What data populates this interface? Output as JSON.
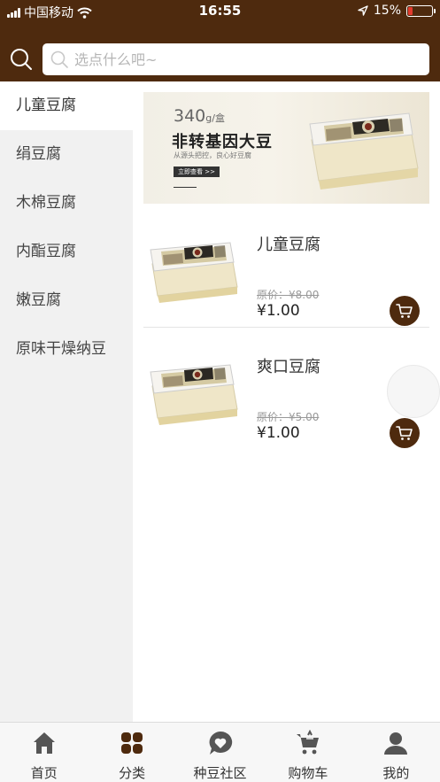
{
  "status_bar": {
    "carrier": "中国移动",
    "time": "16:55",
    "battery": "15%"
  },
  "search": {
    "placeholder": "选点什么吧~"
  },
  "categories": [
    {
      "label": "儿童豆腐",
      "active": true
    },
    {
      "label": "绢豆腐",
      "active": false
    },
    {
      "label": "木棉豆腐",
      "active": false
    },
    {
      "label": "内酯豆腐",
      "active": false
    },
    {
      "label": "嫩豆腐",
      "active": false
    },
    {
      "label": "原味干燥纳豆",
      "active": false
    }
  ],
  "banner": {
    "weight": "340",
    "weight_unit": "g/盒",
    "title": "非转基因大豆",
    "subtitle": "从源头把控，良心好豆腐",
    "button": "立即查看 >>"
  },
  "products": [
    {
      "name": "儿童豆腐",
      "original_price": "原价：¥8.00",
      "price": "¥1.00"
    },
    {
      "name": "爽口豆腐",
      "original_price": "原价：¥5.00",
      "price": "¥1.00"
    }
  ],
  "tabs": [
    {
      "label": "首页",
      "icon": "home-icon"
    },
    {
      "label": "分类",
      "icon": "category-icon"
    },
    {
      "label": "种豆社区",
      "icon": "community-icon"
    },
    {
      "label": "购物车",
      "icon": "cart-icon"
    },
    {
      "label": "我的",
      "icon": "profile-icon"
    }
  ],
  "colors": {
    "brand": "#4e2a0e",
    "sidebar_bg": "#f1f1f1",
    "battery_low": "#e23b2e"
  }
}
